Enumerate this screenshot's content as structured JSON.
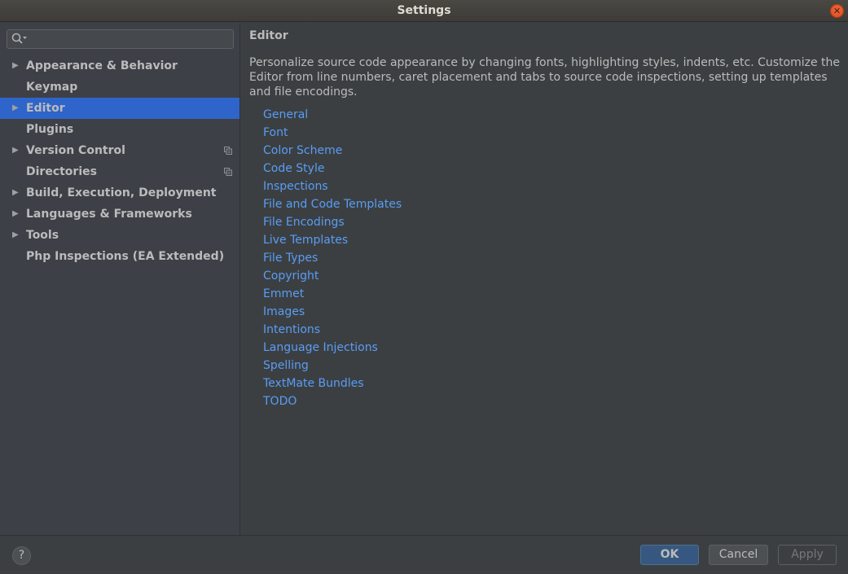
{
  "window": {
    "title": "Settings",
    "close_icon": "close-icon"
  },
  "sidebar": {
    "search": {
      "value": "",
      "placeholder": "",
      "icon": "search-icon"
    },
    "items": [
      {
        "label": "Appearance & Behavior",
        "expandable": true,
        "selected": false,
        "project_icon": false
      },
      {
        "label": "Keymap",
        "expandable": false,
        "selected": false,
        "project_icon": false
      },
      {
        "label": "Editor",
        "expandable": true,
        "selected": true,
        "project_icon": false
      },
      {
        "label": "Plugins",
        "expandable": false,
        "selected": false,
        "project_icon": false
      },
      {
        "label": "Version Control",
        "expandable": true,
        "selected": false,
        "project_icon": true
      },
      {
        "label": "Directories",
        "expandable": false,
        "selected": false,
        "project_icon": true
      },
      {
        "label": "Build, Execution, Deployment",
        "expandable": true,
        "selected": false,
        "project_icon": false
      },
      {
        "label": "Languages & Frameworks",
        "expandable": true,
        "selected": false,
        "project_icon": false
      },
      {
        "label": "Tools",
        "expandable": true,
        "selected": false,
        "project_icon": false
      },
      {
        "label": "Php Inspections (EA Extended)",
        "expandable": false,
        "selected": false,
        "project_icon": false
      }
    ]
  },
  "content": {
    "title": "Editor",
    "description": "Personalize source code appearance by changing fonts, highlighting styles, indents, etc. Customize the Editor from line numbers, caret placement and tabs to source code inspections, setting up templates and file encodings.",
    "links": [
      "General",
      "Font",
      "Color Scheme",
      "Code Style",
      "Inspections",
      "File and Code Templates",
      "File Encodings",
      "Live Templates",
      "File Types",
      "Copyright",
      "Emmet",
      "Images",
      "Intentions",
      "Language Injections",
      "Spelling",
      "TextMate Bundles",
      "TODO"
    ],
    "link_color": "#589df6"
  },
  "footer": {
    "help_label": "?",
    "ok_label": "OK",
    "cancel_label": "Cancel",
    "apply_label": "Apply",
    "apply_enabled": false
  }
}
